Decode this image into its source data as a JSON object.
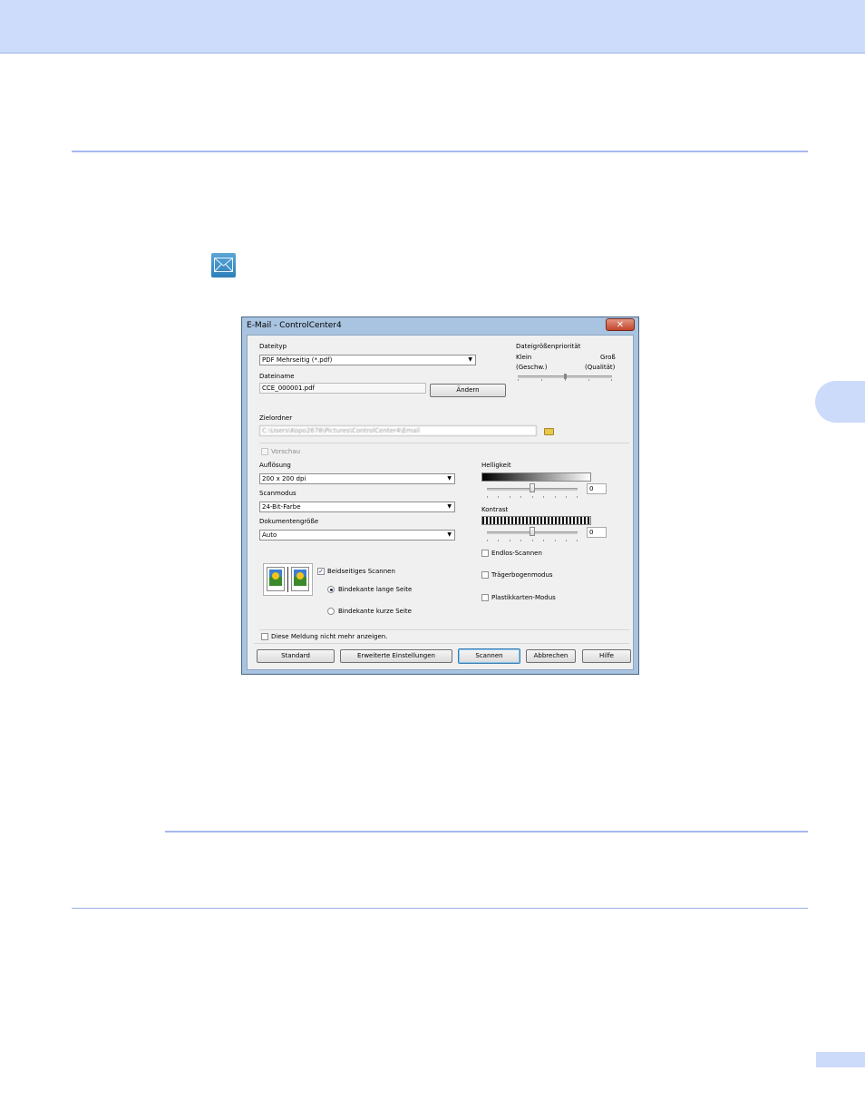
{
  "dialog": {
    "title": "E-Mail - ControlCenter4",
    "close_glyph": "✕",
    "file_type": {
      "label": "Dateityp",
      "value": "PDF Mehrseitig (*.pdf)"
    },
    "file_size_priority": {
      "label": "Dateigrößenpriorität",
      "left": "Klein",
      "left_sub": "(Geschw.)",
      "right": "Groß",
      "right_sub": "(Qualität)"
    },
    "file_name": {
      "label": "Dateiname",
      "value": "CCE_000001.pdf",
      "button": "Ändern"
    },
    "destination": {
      "label": "Zielordner",
      "value": "C:\\Users\\Kopo2678\\Pictures\\ControlCenter4\\Email"
    },
    "preview_label": "Vorschau",
    "resolution": {
      "label": "Auflösung",
      "value": "200 x 200 dpi"
    },
    "scan_mode": {
      "label": "Scanmodus",
      "value": "24-Bit-Farbe"
    },
    "document_size": {
      "label": "Dokumentengröße",
      "value": "Auto"
    },
    "brightness": {
      "label": "Helligkeit",
      "value": "0"
    },
    "contrast": {
      "label": "Kontrast",
      "value": "0"
    },
    "duplex": {
      "label": "Beidseitiges Scannen",
      "checked": true
    },
    "binding_long": "Bindekante lange Seite",
    "binding_short": "Bindekante kurze Seite",
    "continuous_scan": "Endlos-Scannen",
    "carrier_sheet": "Trägerbogenmodus",
    "plastic_card": "Plastikkarten-Modus",
    "dont_show": "Diese Meldung nicht mehr anzeigen.",
    "buttons": {
      "default": "Standard",
      "advanced": "Erweiterte Einstellungen",
      "scan": "Scannen",
      "cancel": "Abbrechen",
      "help": "Hilfe"
    }
  },
  "colors": {
    "header_band": "#cddcfb",
    "rule": "#a8b9f0",
    "dialog_frame": "#a9c4e0"
  },
  "icons": [
    "email-icon",
    "folder-icon",
    "dropdown-arrow-icon",
    "close-icon"
  ]
}
